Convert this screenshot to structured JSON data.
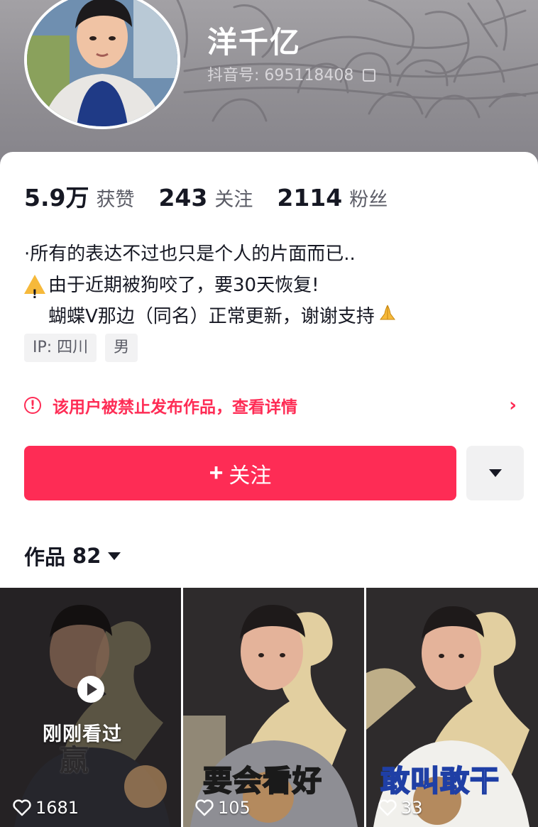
{
  "profile": {
    "username": "洋千亿",
    "douyin_id_label": "抖音号:",
    "douyin_id": "695118408"
  },
  "stats": [
    {
      "num": "5.9万",
      "label": "获赞"
    },
    {
      "num": "243",
      "label": "关注"
    },
    {
      "num": "2114",
      "label": "粉丝"
    }
  ],
  "bio": {
    "line1": "·所有的表达不过也只是个人的片面而已..",
    "line2": "由于近期被狗咬了，要30天恢复!",
    "line3": "蝴蝶Ⅴ那边（同名）正常更新，谢谢支持",
    "line2_icon": "warning-icon",
    "line3_icon": "pray-hands-icon"
  },
  "tags": [
    "IP: 四川",
    "男"
  ],
  "banned_notice": {
    "text": "该用户被禁止发布作品，查看详情",
    "icon": "alert-circle-icon",
    "color": "#fe2c55"
  },
  "actions": {
    "follow_label": "关注",
    "follow_icon": "plus-icon",
    "more_icon": "caret-down-icon",
    "accent": "#fe2c55"
  },
  "works": {
    "label": "作品",
    "count": "82"
  },
  "videos": [
    {
      "overlay": "刚刚看过",
      "caption": "赢",
      "likes": "1681"
    },
    {
      "caption": "要会看好",
      "likes": "105"
    },
    {
      "caption": "敢叫敢干",
      "likes": "33"
    }
  ]
}
